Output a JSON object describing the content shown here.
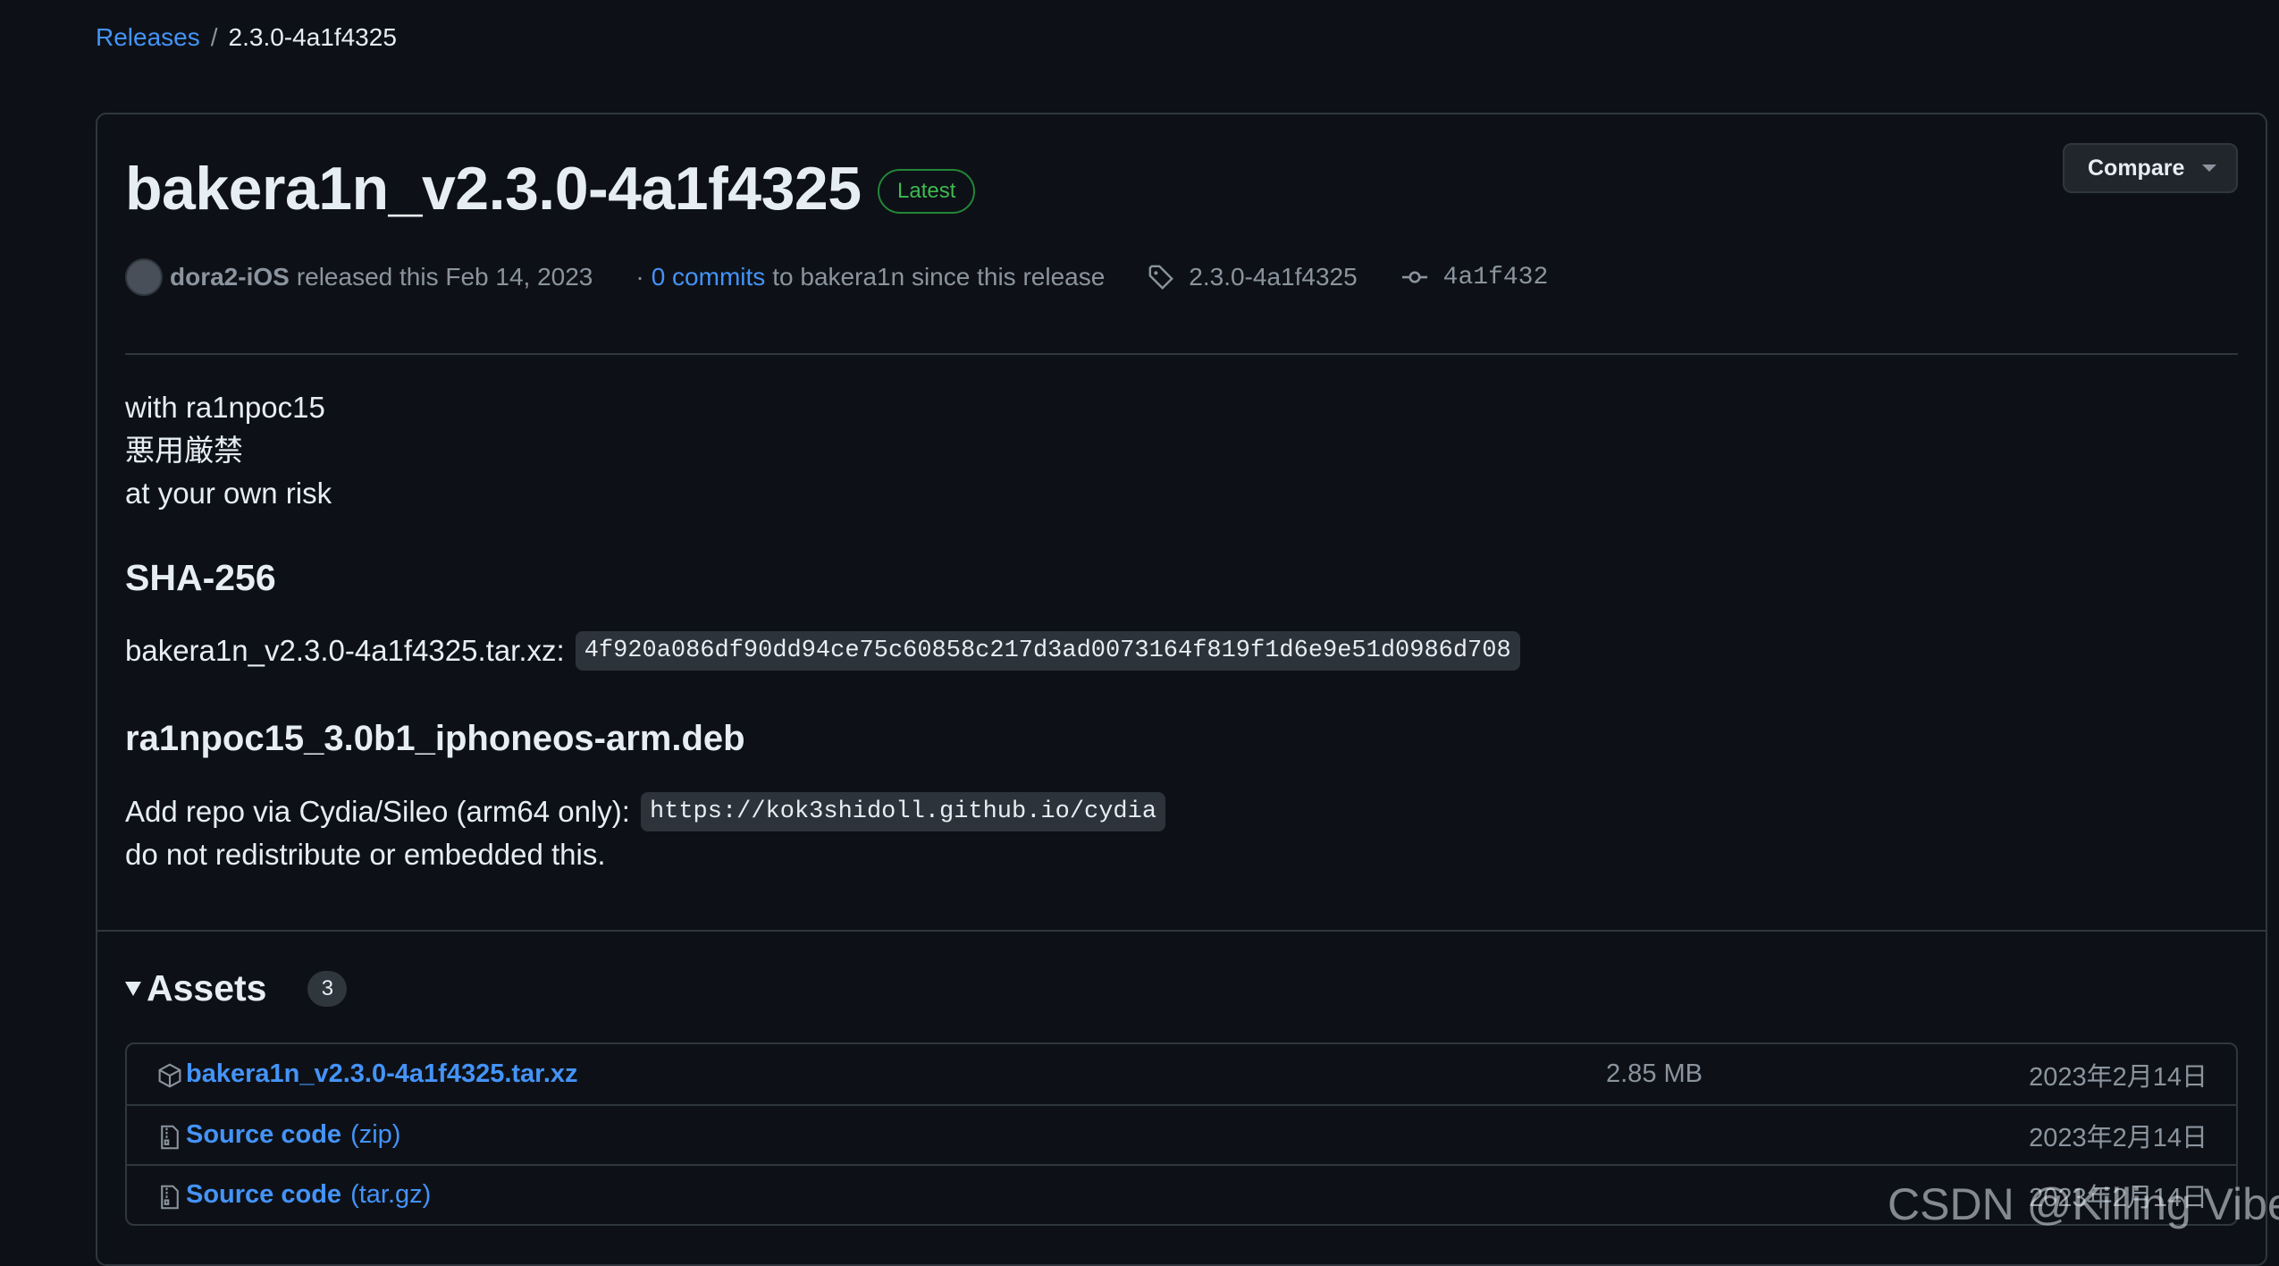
{
  "breadcrumb": {
    "releases_label": "Releases",
    "separator": "/",
    "current": "2.3.0-4a1f4325"
  },
  "release": {
    "title": "bakera1n_v2.3.0-4a1f4325",
    "badge": "Latest",
    "compare_label": "Compare",
    "author": "dora2-iOS",
    "released_text": "released this Feb 14, 2023",
    "commits_prefix": "·",
    "commits_link": "0 commits",
    "commits_suffix": "to bakera1n since this release",
    "tag": "2.3.0-4a1f4325",
    "commit": "4a1f432"
  },
  "notes": {
    "line1": "with ra1npoc15",
    "line2": "悪用厳禁",
    "line3": "at your own risk",
    "sha_heading": "SHA-256",
    "sha_file_label": "bakera1n_v2.3.0-4a1f4325.tar.xz:",
    "sha_value": "4f920a086df90dd94ce75c60858c217d3ad0073164f819f1d6e9e51d0986d708",
    "deb_heading": "ra1npoc15_3.0b1_iphoneos-arm.deb",
    "repo_label": "Add repo via Cydia/Sileo (arm64 only):",
    "repo_url": "https://kok3shidoll.github.io/cydia",
    "redistribute_note": "do not redistribute or embedded this."
  },
  "assets": {
    "title": "Assets",
    "count": "3",
    "items": [
      {
        "name": "bakera1n_v2.3.0-4a1f4325.tar.xz",
        "suffix": "",
        "size": "2.85 MB",
        "date": "2023年2月14日",
        "icon": "package-icon"
      },
      {
        "name": "Source code",
        "suffix": "(zip)",
        "size": "",
        "date": "2023年2月14日",
        "icon": "file-zip-icon"
      },
      {
        "name": "Source code",
        "suffix": "(tar.gz)",
        "size": "",
        "date": "2023年2月14日",
        "icon": "file-zip-icon"
      }
    ]
  },
  "watermark": "CSDN @Killing Vibe",
  "colors": {
    "background": "#0d1117",
    "link": "#4493f8",
    "latest_green": "#3fb950",
    "border": "#30363d"
  }
}
